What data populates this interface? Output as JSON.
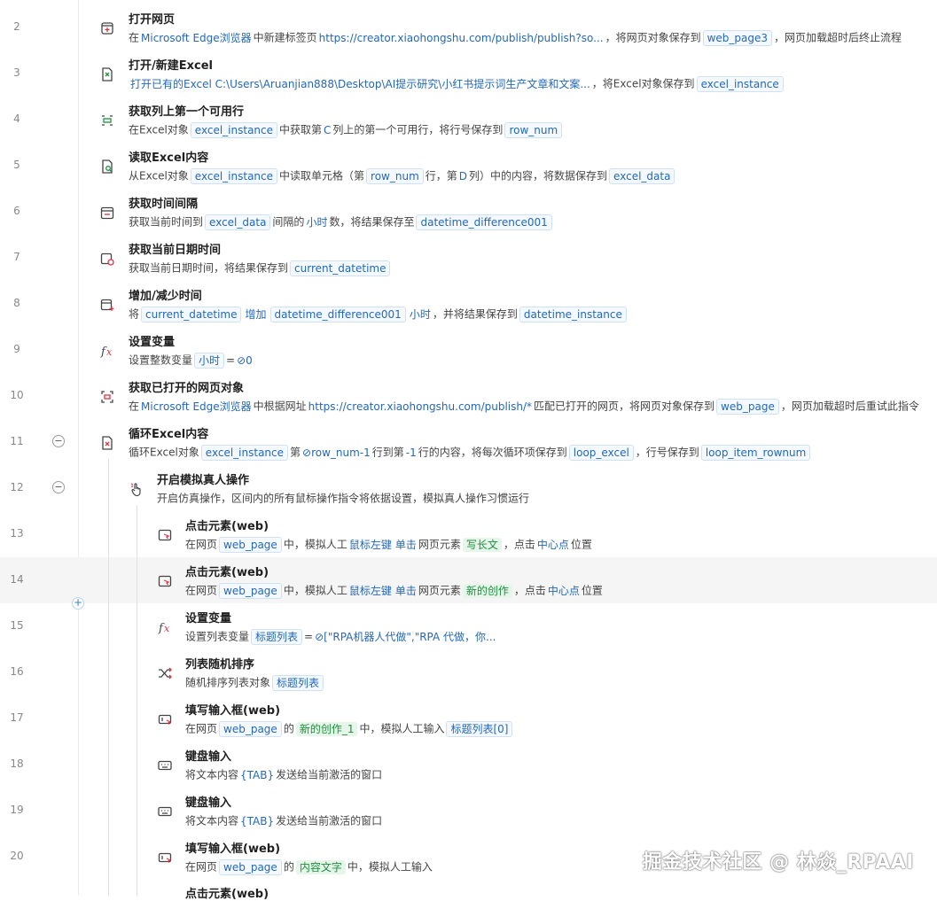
{
  "rows": [
    {
      "num": "2",
      "title": "打开网页",
      "desc": [
        {
          "t": "在"
        },
        {
          "t": "Microsoft Edge浏览器",
          "k": "lnk"
        },
        {
          "t": "中新建标签页"
        },
        {
          "t": "https://creator.xiaohongshu.com/publish/publish?so...",
          "k": "lnk"
        },
        {
          "t": "，将网页对象保存到"
        },
        {
          "t": "web_page3",
          "k": "var"
        },
        {
          "t": "，网页加载超时后终止流程"
        }
      ]
    },
    {
      "num": "3",
      "title": "打开/新建Excel",
      "desc": [
        {
          "t": "打开已有的Excel  C:\\Users\\Aruanjian888\\Desktop\\AI提示研究\\小红书提示词生产文章和文案...",
          "k": "lnk"
        },
        {
          "t": "，将Excel对象保存到"
        },
        {
          "t": "excel_instance",
          "k": "var"
        }
      ]
    },
    {
      "num": "4",
      "title": "获取列上第一个可用行",
      "desc": [
        {
          "t": "在Excel对象"
        },
        {
          "t": "excel_instance",
          "k": "var"
        },
        {
          "t": "中获取第"
        },
        {
          "t": "C",
          "k": "lnk"
        },
        {
          "t": "列上的第一个可用行，将行号保存到"
        },
        {
          "t": "row_num",
          "k": "var"
        }
      ]
    },
    {
      "num": "5",
      "title": "读取Excel内容",
      "desc": [
        {
          "t": "从Excel对象"
        },
        {
          "t": "excel_instance",
          "k": "var"
        },
        {
          "t": "中读取单元格（第"
        },
        {
          "t": "row_num",
          "k": "var"
        },
        {
          "t": "行，第"
        },
        {
          "t": "D",
          "k": "lnk"
        },
        {
          "t": "列）中的内容，将数据保存到"
        },
        {
          "t": "excel_data",
          "k": "var"
        }
      ]
    },
    {
      "num": "6",
      "title": "获取时间间隔",
      "desc": [
        {
          "t": "获取当前时间到"
        },
        {
          "t": "excel_data",
          "k": "var"
        },
        {
          "t": "间隔的"
        },
        {
          "t": "小时",
          "k": "lnk"
        },
        {
          "t": "数，将结果保存至"
        },
        {
          "t": "datetime_difference001",
          "k": "var"
        }
      ]
    },
    {
      "num": "7",
      "title": "获取当前日期时间",
      "desc": [
        {
          "t": "获取当前日期时间，将结果保存到"
        },
        {
          "t": "current_datetime",
          "k": "var"
        }
      ]
    },
    {
      "num": "8",
      "title": "增加/减少时间",
      "desc": [
        {
          "t": "将"
        },
        {
          "t": "current_datetime",
          "k": "var"
        },
        {
          "t": "增加",
          "k": "lnk"
        },
        {
          "t": "datetime_difference001",
          "k": "var"
        },
        {
          "t": "小时",
          "k": "lnk"
        },
        {
          "t": "，并将结果保存到"
        },
        {
          "t": "datetime_instance",
          "k": "var"
        }
      ]
    },
    {
      "num": "9",
      "title": "设置变量",
      "desc": [
        {
          "t": "设置整数变量"
        },
        {
          "t": "小时",
          "k": "var"
        },
        {
          "t": "="
        },
        {
          "t": "⊘0",
          "k": "lnk"
        }
      ]
    },
    {
      "num": "10",
      "title": "获取已打开的网页对象",
      "desc": [
        {
          "t": "在"
        },
        {
          "t": "Microsoft Edge浏览器",
          "k": "lnk"
        },
        {
          "t": "中根据网址"
        },
        {
          "t": "https://creator.xiaohongshu.com/publish/*",
          "k": "lnk"
        },
        {
          "t": "匹配已打开的网页，将网页对象保存到"
        },
        {
          "t": "web_page",
          "k": "var"
        },
        {
          "t": "，网页加载超时后重试此指令"
        }
      ]
    },
    {
      "num": "11",
      "title": "循环Excel内容",
      "desc": [
        {
          "t": "循环Excel对象"
        },
        {
          "t": "excel_instance",
          "k": "var"
        },
        {
          "t": "第"
        },
        {
          "t": "⊘row_num-1",
          "k": "lnk"
        },
        {
          "t": "行到第"
        },
        {
          "t": "-1",
          "k": "lnk"
        },
        {
          "t": "行的内容，将每次循环项保存到"
        },
        {
          "t": "loop_excel",
          "k": "var"
        },
        {
          "t": "，行号保存到"
        },
        {
          "t": "loop_item_rownum",
          "k": "var"
        }
      ]
    },
    {
      "num": "12",
      "title": "开启模拟真人操作",
      "desc": [
        {
          "t": "开启仿真操作，区间内的所有鼠标操作指令将依据设置，模拟真人操作习惯运行"
        }
      ]
    },
    {
      "num": "13",
      "title": "点击元素(web)",
      "desc": [
        {
          "t": "在网页"
        },
        {
          "t": "web_page",
          "k": "var"
        },
        {
          "t": "中，模拟人工"
        },
        {
          "t": "鼠标左键",
          "k": "lnk"
        },
        {
          "t": "单击",
          "k": "lnk"
        },
        {
          "t": "网页元素"
        },
        {
          "t": "写长文",
          "k": "el"
        },
        {
          "t": "，点击"
        },
        {
          "t": "中心点",
          "k": "lnk"
        },
        {
          "t": "位置"
        }
      ]
    },
    {
      "num": "14",
      "title": "点击元素(web)",
      "desc": [
        {
          "t": "在网页"
        },
        {
          "t": "web_page",
          "k": "var"
        },
        {
          "t": "中，模拟人工"
        },
        {
          "t": "鼠标左键",
          "k": "lnk"
        },
        {
          "t": "单击",
          "k": "lnk"
        },
        {
          "t": "网页元素"
        },
        {
          "t": "新的创作",
          "k": "el"
        },
        {
          "t": "，点击"
        },
        {
          "t": "中心点",
          "k": "lnk"
        },
        {
          "t": "位置"
        }
      ]
    },
    {
      "num": "15",
      "title": "设置变量",
      "desc": [
        {
          "t": "设置列表变量"
        },
        {
          "t": "标题列表",
          "k": "var"
        },
        {
          "t": "="
        },
        {
          "t": "⊘[\"RPA机器人代做\",\"RPA 代做，你...",
          "k": "lnk"
        }
      ]
    },
    {
      "num": "16",
      "title": "列表随机排序",
      "desc": [
        {
          "t": "随机排序列表对象"
        },
        {
          "t": "标题列表",
          "k": "var"
        }
      ]
    },
    {
      "num": "17",
      "title": "填写输入框(web)",
      "desc": [
        {
          "t": "在网页"
        },
        {
          "t": "web_page",
          "k": "var"
        },
        {
          "t": "的"
        },
        {
          "t": "新的创作_1",
          "k": "el"
        },
        {
          "t": "中，模拟人工输入"
        },
        {
          "t": "标题列表[0]",
          "k": "var"
        }
      ]
    },
    {
      "num": "18",
      "title": "键盘输入",
      "desc": [
        {
          "t": "将文本内容"
        },
        {
          "t": "{TAB}",
          "k": "lnk"
        },
        {
          "t": "发送给当前激活的窗口"
        }
      ]
    },
    {
      "num": "19",
      "title": "键盘输入",
      "desc": [
        {
          "t": "将文本内容"
        },
        {
          "t": "{TAB}",
          "k": "lnk"
        },
        {
          "t": "发送给当前激活的窗口"
        }
      ]
    },
    {
      "num": "20",
      "title": "填写输入框(web)",
      "desc": [
        {
          "t": "在网页"
        },
        {
          "t": "web_page",
          "k": "var"
        },
        {
          "t": "的"
        },
        {
          "t": "内容文字",
          "k": "el"
        },
        {
          "t": "中，模拟人工输入"
        }
      ]
    }
  ],
  "partial_title": "点击元素(web)",
  "watermark": "掘金技术社区 @ 林焱_RPAAI",
  "icons": [
    "new-tab-icon",
    "excel-new-icon",
    "column-row-icon",
    "excel-read-icon",
    "time-interval-icon",
    "datetime-icon",
    "calendar-add-icon",
    "fx-icon",
    "web-object-icon",
    "excel-loop-icon",
    "hand-pointer-icon",
    "click-element-icon",
    "click-element-icon",
    "fx-icon",
    "shuffle-icon",
    "input-field-icon",
    "keyboard-icon",
    "keyboard-icon",
    "input-field-icon"
  ]
}
